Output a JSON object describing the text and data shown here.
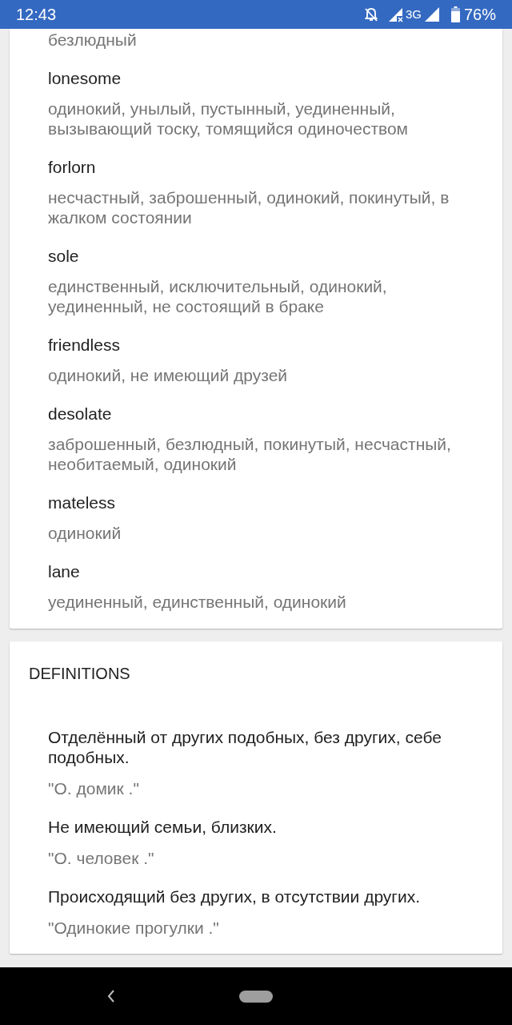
{
  "status_bar": {
    "time": "12:43",
    "network": "3G",
    "battery": "76%"
  },
  "synonyms": [
    {
      "translation": "безлюдный"
    },
    {
      "word": "lonesome",
      "translation": "одинокий, унылый, пустынный, уединенный, вызывающий тоску, томящийся одиночеством"
    },
    {
      "word": "forlorn",
      "translation": "несчастный, заброшенный, одинокий, покинутый, в жалком состоянии"
    },
    {
      "word": "sole",
      "translation": "единственный, исключительный, одинокий, уединенный, не состоящий в браке"
    },
    {
      "word": "friendless",
      "translation": "одинокий, не имеющий друзей"
    },
    {
      "word": "desolate",
      "translation": "заброшенный, безлюдный, покинутый, несчастный, необитаемый, одинокий"
    },
    {
      "word": "mateless",
      "translation": "одинокий"
    },
    {
      "word": "lane",
      "translation": "уединенный, единственный, одинокий"
    }
  ],
  "definitions": {
    "title": "DEFINITIONS",
    "items": [
      {
        "text": "Отделённый от других подобных, без других, себе подобных.",
        "example": "\"О. домик .\""
      },
      {
        "text": "Не имеющий семьи, близких.",
        "example": "\"О. человек .\""
      },
      {
        "text": "Происходящий без других, в отсутствии других.",
        "example": "\"Одинокие прогулки .\""
      }
    ]
  }
}
